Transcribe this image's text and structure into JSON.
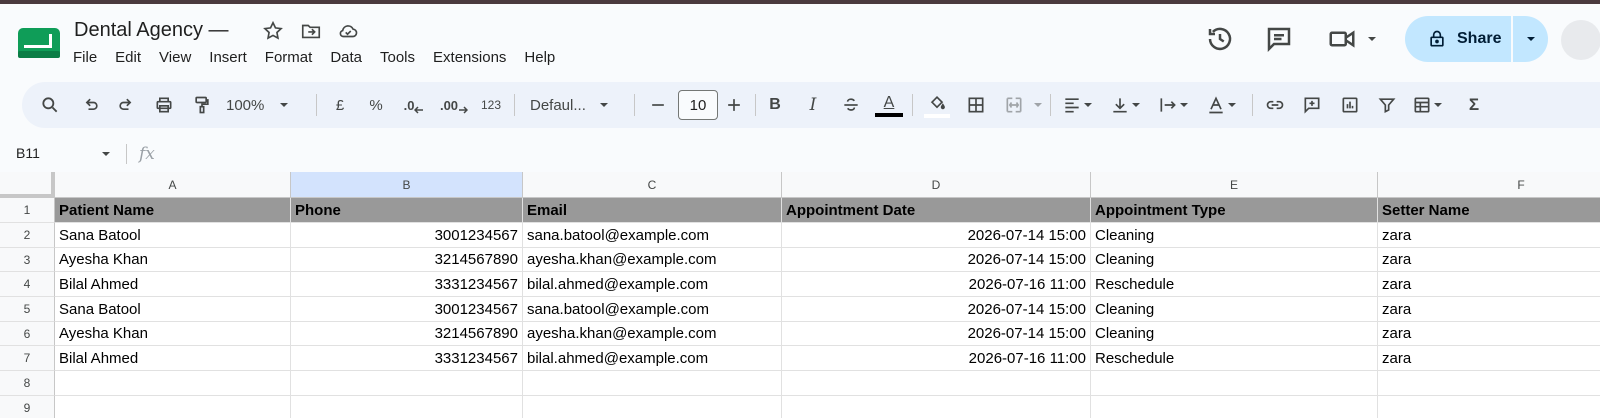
{
  "app": {
    "doc_title": "Dental Agency —",
    "menu": [
      "File",
      "Edit",
      "View",
      "Insert",
      "Format",
      "Data",
      "Tools",
      "Extensions",
      "Help"
    ],
    "share_label": "Share"
  },
  "toolbar": {
    "zoom": "100%",
    "currency": "£",
    "percent": "%",
    "dec_decrease": ".0",
    "dec_increase": ".00",
    "number_format": "123",
    "font": "Defaul...",
    "font_size": "10",
    "bold": "B",
    "italic": "I",
    "text_color": "A",
    "sum": "Σ"
  },
  "formula_bar": {
    "cell_ref": "B11",
    "fx": "fx"
  },
  "sheet": {
    "columns": [
      "A",
      "B",
      "C",
      "D",
      "E",
      "F"
    ],
    "row_numbers": [
      "1",
      "2",
      "3",
      "4",
      "5",
      "6",
      "7",
      "8",
      "9"
    ],
    "selected_column": "B",
    "header_row": [
      "Patient Name",
      "Phone",
      "Email",
      "Appointment Date",
      "Appointment Type",
      "Setter Name"
    ],
    "rows": [
      [
        "Sana Batool",
        "3001234567",
        "sana.batool@example.com",
        "2026-07-14 15:00",
        "Cleaning",
        "zara"
      ],
      [
        "Ayesha Khan",
        "3214567890",
        "ayesha.khan@example.com",
        "2026-07-14 15:00",
        "Cleaning",
        "zara"
      ],
      [
        "Bilal Ahmed",
        "3331234567",
        "bilal.ahmed@example.com",
        "2026-07-16 11:00",
        "Reschedule",
        "zara"
      ],
      [
        "Sana Batool",
        "3001234567",
        "sana.batool@example.com",
        "2026-07-14 15:00",
        "Cleaning",
        "zara"
      ],
      [
        "Ayesha Khan",
        "3214567890",
        "ayesha.khan@example.com",
        "2026-07-14 15:00",
        "Cleaning",
        "zara"
      ],
      [
        "Bilal Ahmed",
        "3331234567",
        "bilal.ahmed@example.com",
        "2026-07-16 11:00",
        "Reschedule",
        "zara"
      ]
    ]
  },
  "colors": {
    "header_fill": "#999999",
    "selected_column": "#d3e3fd",
    "share_button": "#c2e7ff",
    "logo": "#0f9d58"
  }
}
